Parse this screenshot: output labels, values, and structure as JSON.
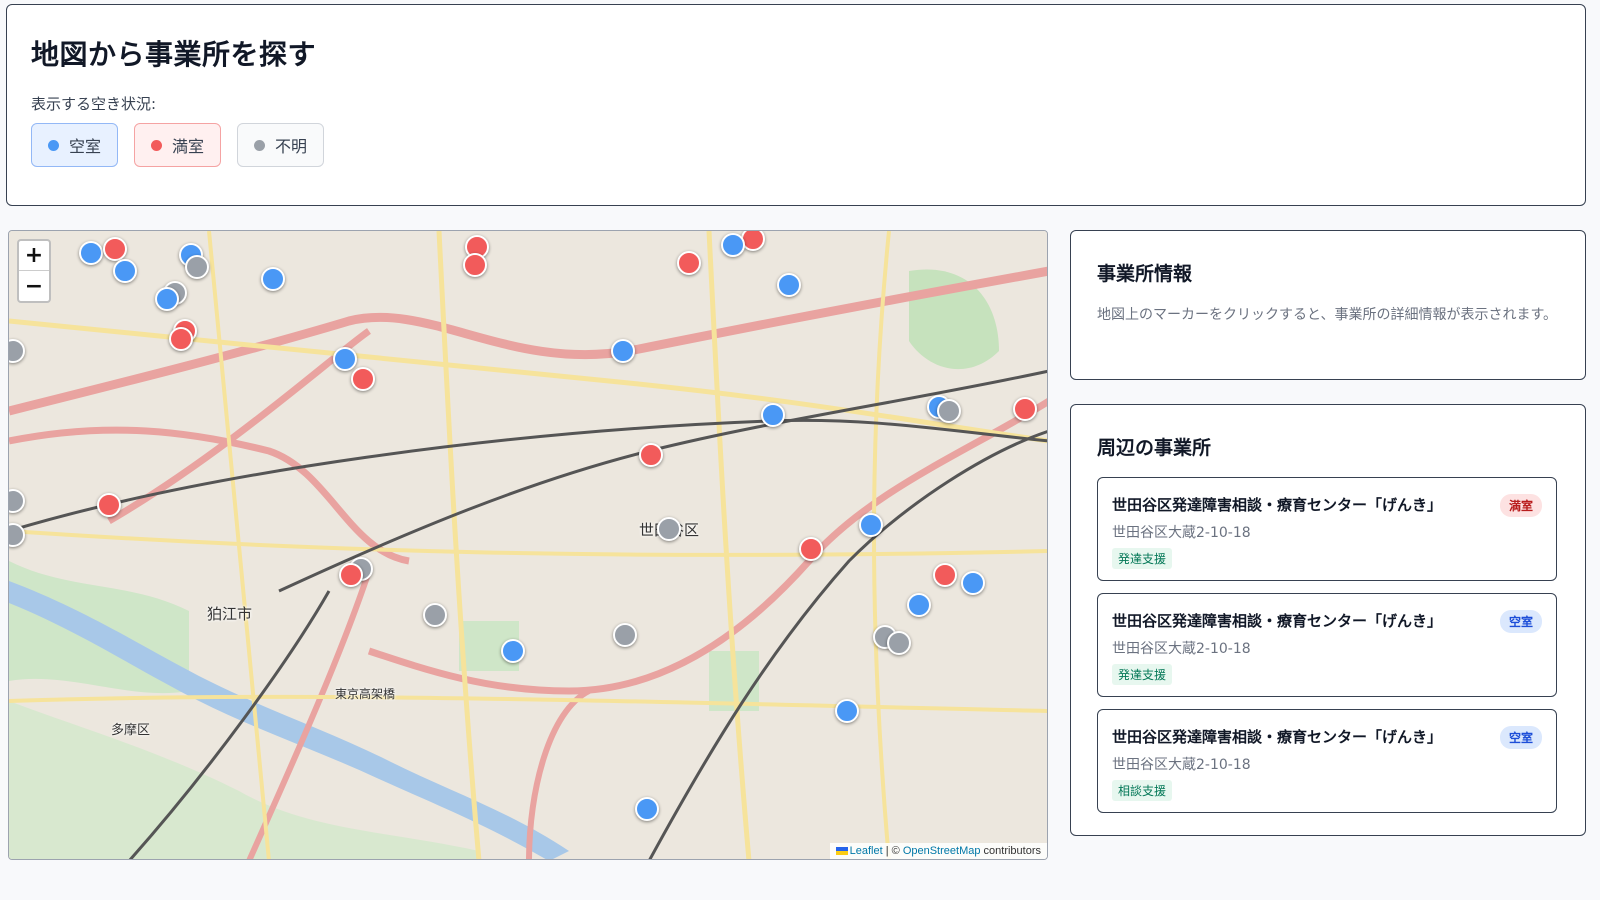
{
  "header": {
    "title": "地図から事業所を探す",
    "filter_label": "表示する空き状況:",
    "filters": [
      {
        "label": "空室",
        "color": "#4a98f5"
      },
      {
        "label": "満室",
        "color": "#f25b5b"
      },
      {
        "label": "不明",
        "color": "#9aa0a8"
      }
    ]
  },
  "map": {
    "zoom_in": "+",
    "zoom_out": "−",
    "labels": [
      "世田谷区",
      "狛江市",
      "多摩区",
      "東京高架橋"
    ],
    "attribution": {
      "leaflet": "Leaflet",
      "sep": " | © ",
      "osm": "OpenStreetMap",
      "suffix": " contributors"
    }
  },
  "info_panel": {
    "title": "事業所情報",
    "text": "地図上のマーカーをクリックすると、事業所の詳細情報が表示されます。"
  },
  "nearby": {
    "title": "周辺の事業所",
    "items": [
      {
        "name": "世田谷区発達障害相談・療育センター「げんき」",
        "address": "世田谷区大蔵2-10-18",
        "tag": "発達支援",
        "status": "満室"
      },
      {
        "name": "世田谷区発達障害相談・療育センター「げんき」",
        "address": "世田谷区大蔵2-10-18",
        "tag": "発達支援",
        "status": "空室"
      },
      {
        "name": "世田谷区発達障害相談・療育センター「げんき」",
        "address": "世田谷区大蔵2-10-18",
        "tag": "相談支援",
        "status": "空室"
      }
    ]
  }
}
